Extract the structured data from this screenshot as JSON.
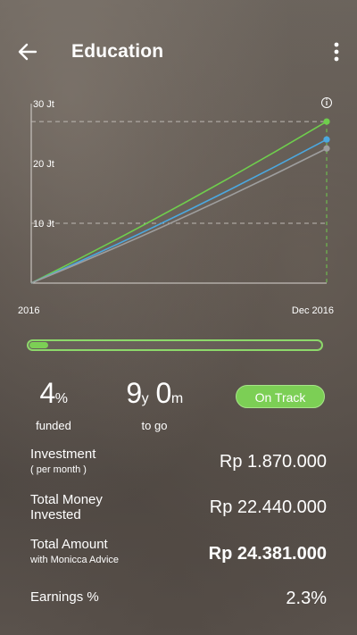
{
  "app_bar": {
    "title": "Education",
    "back_icon": "arrow-left-icon",
    "menu_icon": "more-vertical-icon"
  },
  "chart_data": {
    "type": "line",
    "x_labels": [
      "2016",
      "Dec 2016"
    ],
    "y_ticks": [
      "10 Jt",
      "20 Jt",
      "30 Jt"
    ],
    "ylim": [
      0,
      30
    ],
    "series": [
      {
        "color": "#6fce4d",
        "values": [
          0,
          27
        ]
      },
      {
        "color": "#4ba8e0",
        "values": [
          0,
          24
        ]
      },
      {
        "color": "#9e9e9e",
        "values": [
          0,
          22.5
        ]
      }
    ],
    "reference_lines": [
      10,
      27
    ],
    "info_icon": "info-icon"
  },
  "progress": {
    "percent": 0.04
  },
  "stats": {
    "funded_value": "4",
    "funded_unit": "%",
    "funded_label": "funded",
    "years_value": "9",
    "years_unit": "y",
    "months_value": "0",
    "months_unit": "m",
    "togo_label": "to go",
    "status": "On Track"
  },
  "rows": {
    "investment_label": "Investment",
    "investment_sub": "( per month )",
    "investment_value": "Rp 1.870.000",
    "total_invested_label_1": "Total Money",
    "total_invested_label_2": "Invested",
    "total_invested_value": "Rp 22.440.000",
    "total_amount_label": "Total Amount",
    "total_amount_sub": "with Monicca Advice",
    "total_amount_value": "Rp 24.381.000",
    "earnings_label": "Earnings %",
    "earnings_value": "2.3%"
  },
  "colors": {
    "accent": "#7ccf55",
    "blue": "#4ba8e0",
    "grey": "#9e9e9e"
  }
}
